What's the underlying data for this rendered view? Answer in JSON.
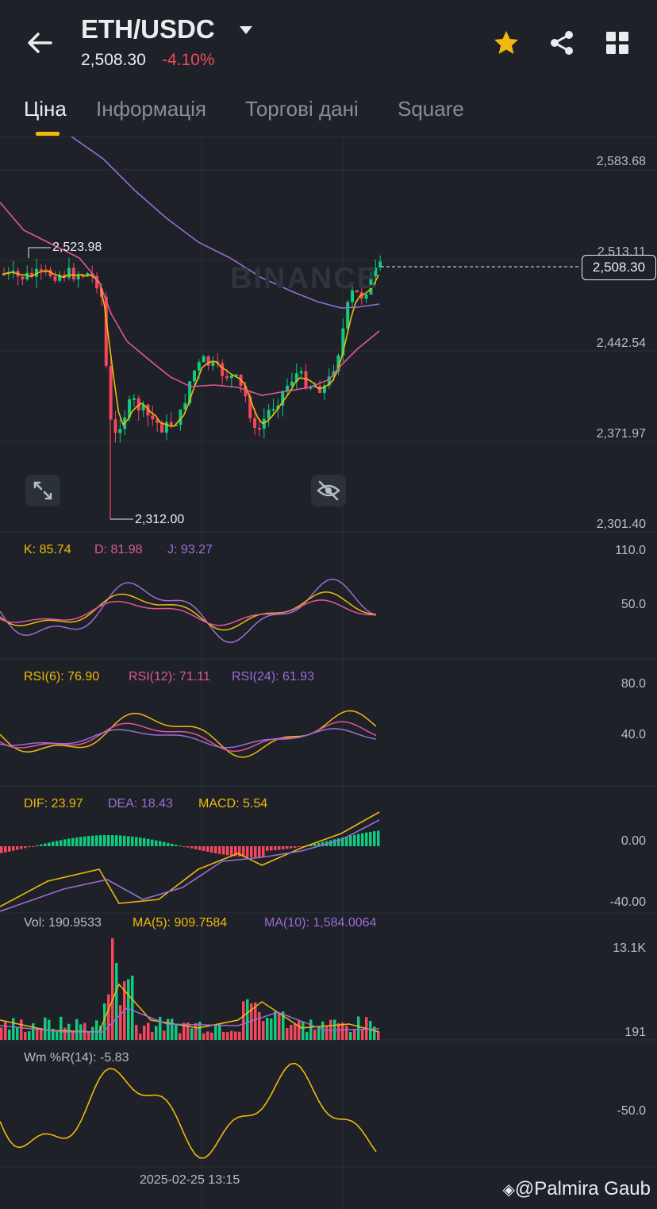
{
  "header": {
    "pair": "ETH/USDC",
    "price": "2,508.30",
    "change": "-4.10%",
    "icons": [
      "back-arrow-icon",
      "caret-down-icon",
      "star-icon",
      "share-icon",
      "grid-icon"
    ],
    "colors": {
      "up": "#0ecb81",
      "down": "#f6465d",
      "accent": "#f0b90b"
    }
  },
  "tabs": [
    {
      "label": "Ціна",
      "active": true
    },
    {
      "label": "Інформація",
      "active": false
    },
    {
      "label": "Торгові дані",
      "active": false
    },
    {
      "label": "Square",
      "active": false
    }
  ],
  "main_chart": {
    "watermark": "BINANCE",
    "axis": [
      "2,583.68",
      "2,513.11",
      "2,442.54",
      "2,371.97",
      "2,301.40"
    ],
    "current_price_tag": "2,508.30",
    "high_label": "2,523.98",
    "low_label": "2,312.00"
  },
  "kdj": {
    "k": "K: 85.74",
    "d": "D: 81.98",
    "j": "J: 93.27",
    "axis": [
      "110.0",
      "50.0"
    ]
  },
  "rsi": {
    "r6": "RSI(6): 76.90",
    "r12": "RSI(12): 71.11",
    "r24": "RSI(24): 61.93",
    "axis": [
      "80.0",
      "40.0"
    ]
  },
  "macd": {
    "dif": "DIF: 23.97",
    "dea": "DEA: 18.43",
    "macd": "MACD: 5.54",
    "axis": [
      "0.00",
      "-40.00"
    ]
  },
  "vol": {
    "vol": "Vol: 190.9533",
    "ma5": "MA(5): 909.7584",
    "ma10": "MA(10): 1,584.0064",
    "axis": [
      "13.1K",
      "191"
    ]
  },
  "wr": {
    "label": "Wm %R(14): -5.83",
    "axis": [
      "-50.0"
    ]
  },
  "time_label": "2025-02-25 13:15",
  "attribution": "@Palmira Gaub"
}
